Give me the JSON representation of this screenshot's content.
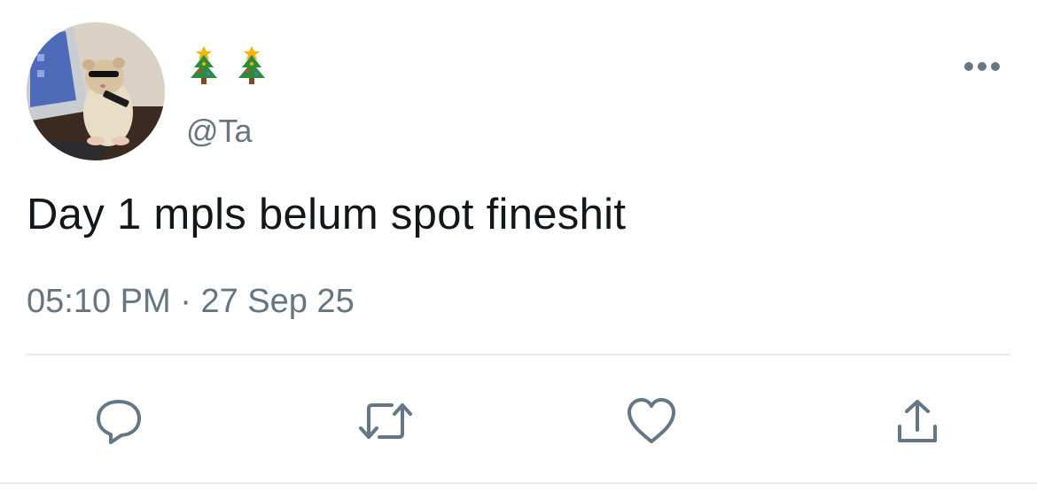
{
  "author": {
    "display_name_icons": [
      "christmas-tree-emoji",
      "christmas-tree-emoji"
    ],
    "handle": "@Ta"
  },
  "tweet": {
    "text": "Day 1 mpls belum spot fineshit",
    "time": "05:10 PM",
    "separator": "·",
    "date": "27 Sep 25"
  },
  "actions": {
    "icons": [
      "reply-icon",
      "retweet-icon",
      "like-icon",
      "share-icon"
    ]
  },
  "colors": {
    "secondary_text": "#66757f",
    "primary_text": "#14171a",
    "icon": "#657786",
    "divider": "#e6ecf0"
  }
}
